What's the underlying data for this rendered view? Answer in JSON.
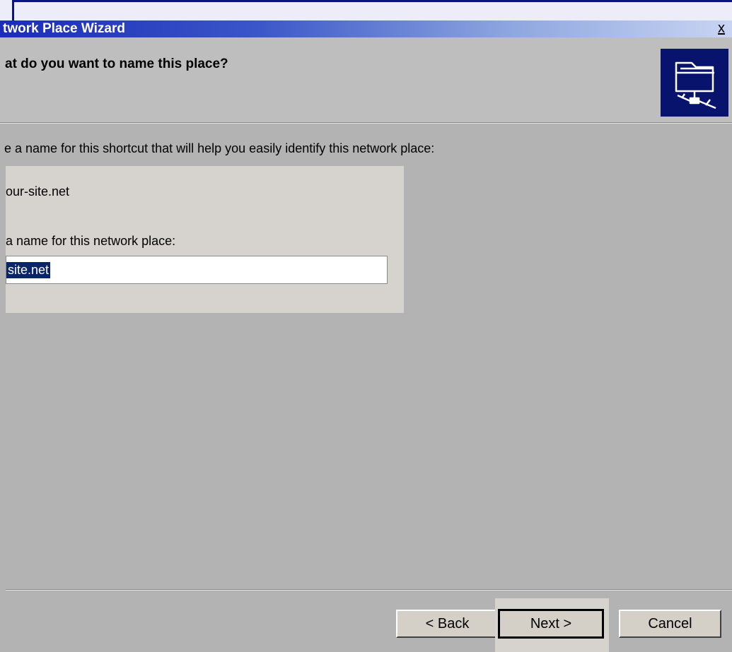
{
  "window": {
    "title": "twork Place Wizard",
    "close_glyph": "x"
  },
  "header": {
    "heading": "at do you want to name this place?",
    "icon": "network-folder-icon"
  },
  "body": {
    "instruction": "e a name for this shortcut that will help you easily identify this network place:",
    "address_value": "our-site.net",
    "name_label": "a name for this network place:",
    "name_value": "site.net"
  },
  "buttons": {
    "back": "< Back",
    "next": "Next >",
    "cancel": "Cancel"
  },
  "colors": {
    "title_bar": "#1b2cb8",
    "icon_bg": "#08136e",
    "selection": "#0a246a",
    "window_bg": "#b3b3b3"
  }
}
